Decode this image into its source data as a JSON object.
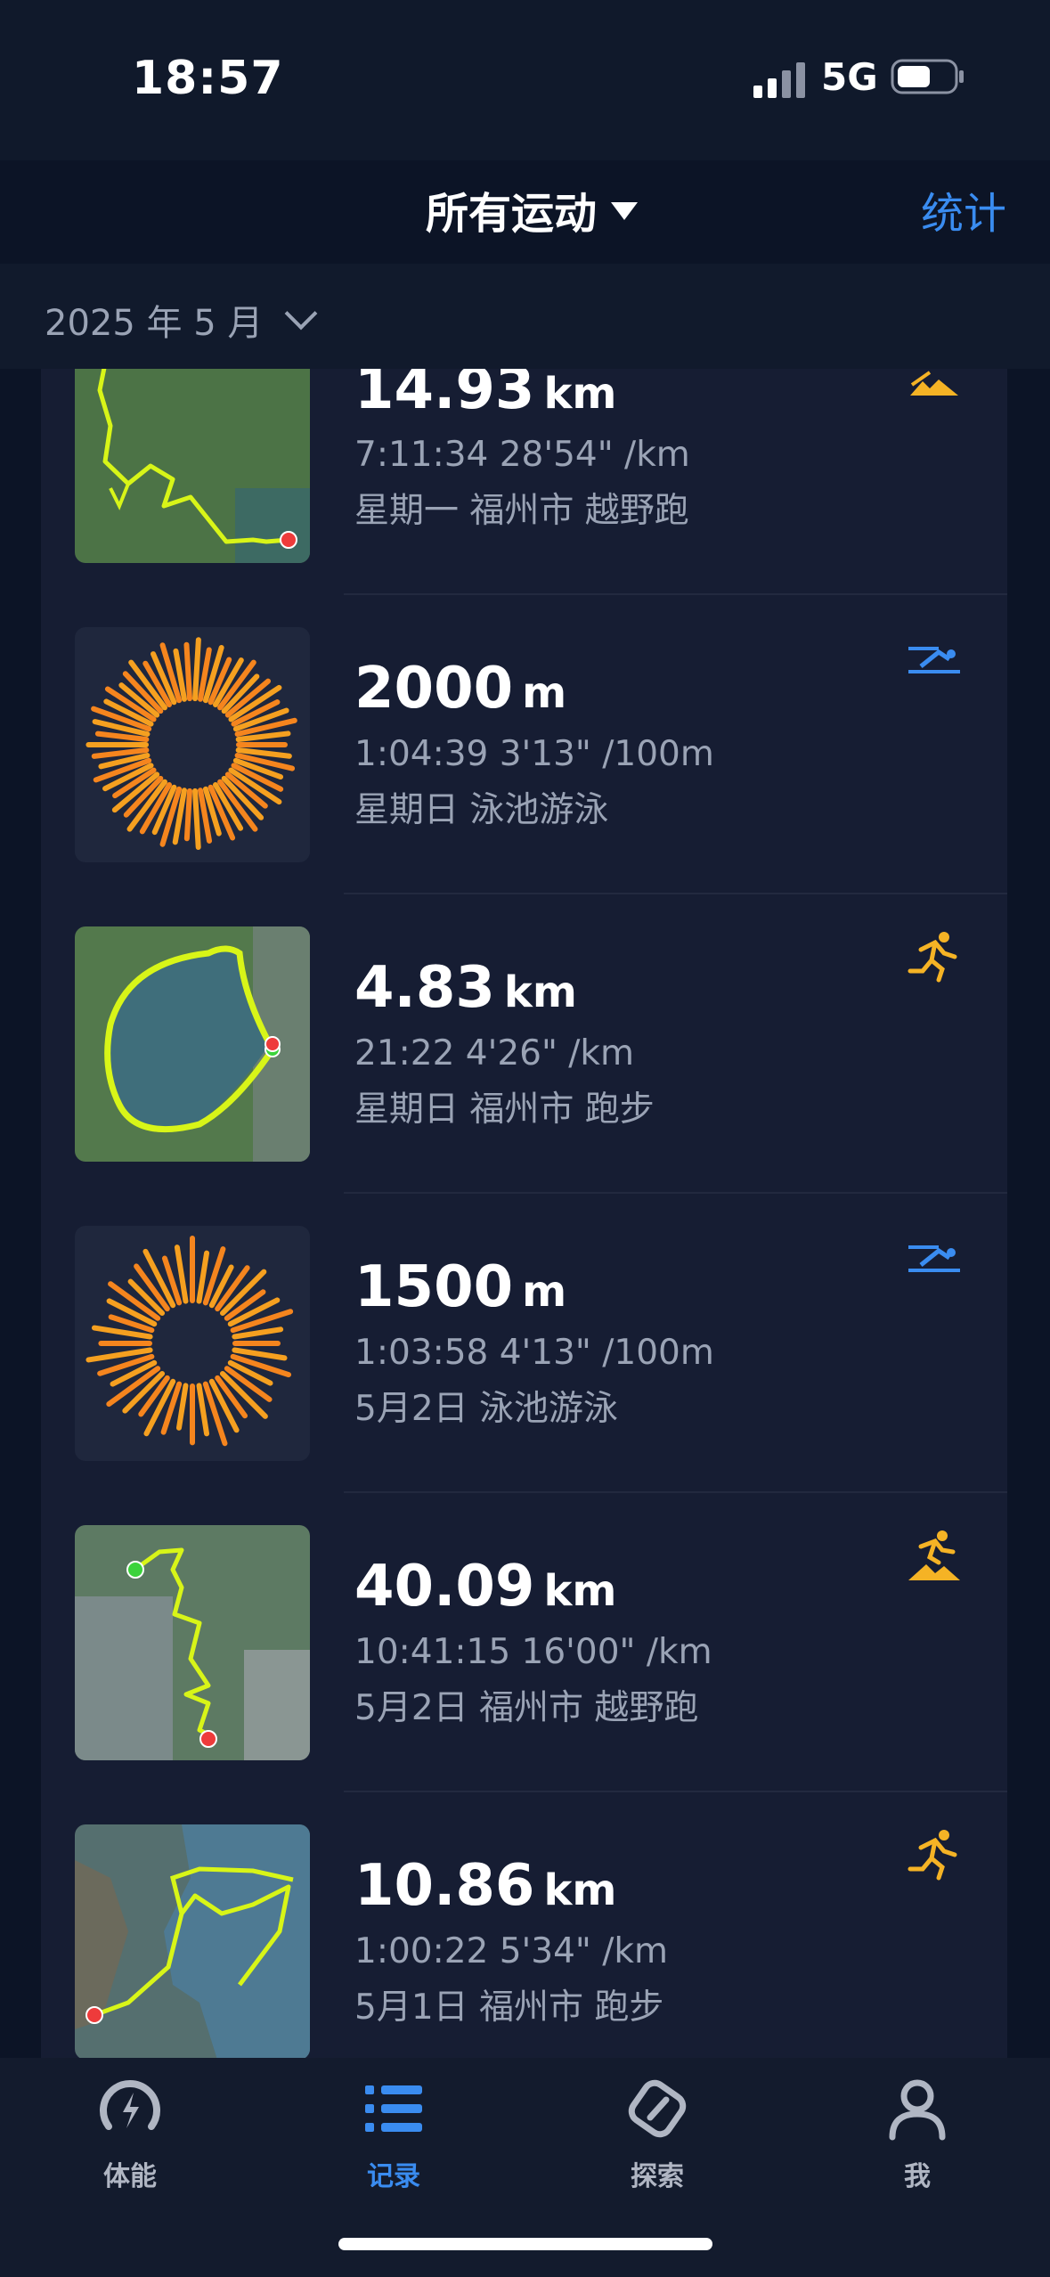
{
  "status": {
    "time": "18:57",
    "network": "5G"
  },
  "nav": {
    "title": "所有运动",
    "stats": "统计"
  },
  "month": "2025 年 5 月",
  "activities": [
    {
      "distance": "14.93",
      "unit": "km",
      "metrics": "7:11:34  28'54\" /km",
      "detail": "星期一 福州市 越野跑",
      "sport": "trail-run"
    },
    {
      "distance": "2000",
      "unit": "m",
      "metrics": "1:04:39  3'13\" /100m",
      "detail": "星期日 泳池游泳",
      "sport": "pool-swim"
    },
    {
      "distance": "4.83",
      "unit": "km",
      "metrics": "21:22  4'26\" /km",
      "detail": "星期日 福州市 跑步",
      "sport": "run"
    },
    {
      "distance": "1500",
      "unit": "m",
      "metrics": "1:03:58  4'13\" /100m",
      "detail": "5月2日 泳池游泳",
      "sport": "pool-swim"
    },
    {
      "distance": "40.09",
      "unit": "km",
      "metrics": "10:41:15  16'00\" /km",
      "detail": "5月2日 福州市 越野跑",
      "sport": "trail-run"
    },
    {
      "distance": "10.86",
      "unit": "km",
      "metrics": "1:00:22  5'34\" /km",
      "detail": "5月1日 福州市 跑步",
      "sport": "run"
    }
  ],
  "tabs": [
    {
      "label": "体能",
      "icon": "fitness-icon"
    },
    {
      "label": "记录",
      "icon": "list-icon",
      "active": true
    },
    {
      "label": "探索",
      "icon": "compass-icon"
    },
    {
      "label": "我",
      "icon": "person-icon"
    }
  ],
  "colors": {
    "accent": "#3a8cf0",
    "route": "#d8f518",
    "run": "#f5b325",
    "swim": "#3a8cf0"
  }
}
